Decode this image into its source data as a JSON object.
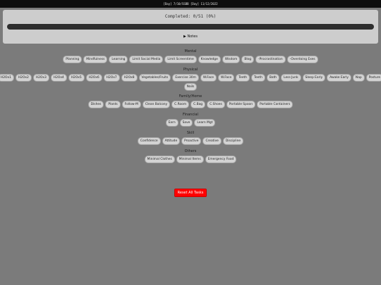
{
  "topbar": {
    "text": "[Day] 7/10/SSBB [Day] 11/12/2022"
  },
  "progress": {
    "completed_text": "Completed: 0/51 (0%)",
    "fraction": 0
  },
  "notes": {
    "label": "▶ Notes"
  },
  "sections": {
    "mental": {
      "title": "Mental",
      "tasks": [
        "Planning",
        "Mindfulness",
        "Learning",
        "Limit Social Media",
        "Limit Screentime",
        "Knowledge",
        "Wisdom",
        "Blog",
        "-Procrastination",
        "-Overdoing Exes"
      ]
    },
    "physical": {
      "title": "Physical",
      "tasks_row1": [
        "H2Ox1",
        "H2Ox2",
        "H2Ox3",
        "H2Ox4",
        "H2Ox5",
        "H2Ox6",
        "H2Ox7",
        "H2Ox8",
        "Vegetables/Fruits",
        "Exercise 30m",
        "W.Face",
        "W.Face",
        "Teeth",
        "Teeth",
        "Bath",
        "Less Junk",
        "Sleep Early",
        "Awake Early",
        "Nap",
        "Posture"
      ],
      "tasks_row2": [
        "Nails"
      ]
    },
    "family": {
      "title": "Family/Home",
      "tasks": [
        "Dishes",
        "Plants",
        "Follow-M",
        "Clean Balcony",
        "C.Room",
        "C.Bag",
        "C.Shoes",
        "Portable Spoon",
        "Portable Containers"
      ]
    },
    "financial": {
      "title": "Financial",
      "tasks": [
        "Earn",
        "Save",
        "Learn Mgt"
      ]
    },
    "skill": {
      "title": "Skill",
      "tasks": [
        "Confidence",
        "Attitude",
        "Proactive",
        "Creative",
        "Discipline"
      ]
    },
    "others": {
      "title": "Others",
      "tasks": [
        "Minimal Clothes",
        "Minimal Items",
        "Emergency Food"
      ]
    }
  },
  "reset": {
    "label": "Reset All Tasks"
  }
}
